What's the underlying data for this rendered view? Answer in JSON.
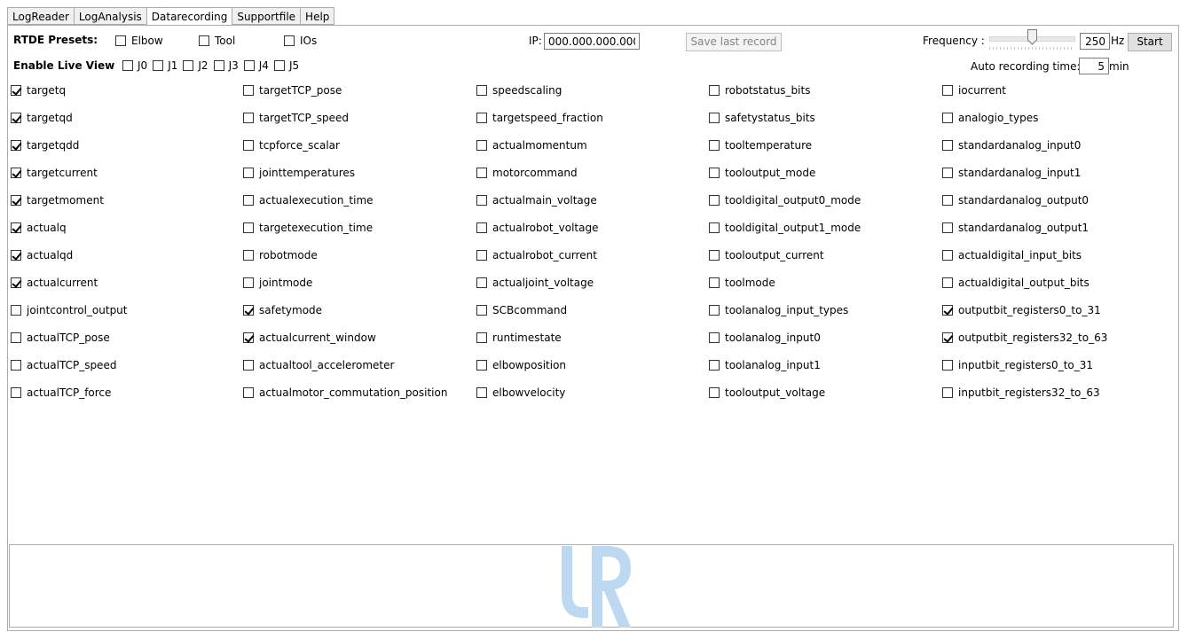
{
  "tabs": [
    "LogReader",
    "LogAnalysis",
    "Datarecording",
    "Supportfile",
    "Help"
  ],
  "active_tab": "Datarecording",
  "presets": {
    "label": "RTDE Presets:",
    "items": [
      {
        "label": "Elbow",
        "checked": false
      },
      {
        "label": "Tool",
        "checked": false
      },
      {
        "label": "IOs",
        "checked": false
      }
    ]
  },
  "ip": {
    "label": "IP:",
    "value": "000.000.000.000"
  },
  "save_button": "Save last record",
  "frequency": {
    "label": "Frequency :",
    "value": "250",
    "unit": "Hz",
    "slider_fraction": 0.5
  },
  "start_button": "Start",
  "live_view": {
    "label": "Enable Live View",
    "joints": [
      {
        "label": "J0",
        "checked": false
      },
      {
        "label": "J1",
        "checked": false
      },
      {
        "label": "J2",
        "checked": false
      },
      {
        "label": "J3",
        "checked": false
      },
      {
        "label": "J4",
        "checked": false
      },
      {
        "label": "J5",
        "checked": false
      }
    ]
  },
  "auto_recording": {
    "label": "Auto recording time:",
    "value": "5",
    "unit": "min"
  },
  "columns": [
    [
      {
        "label": "targetq",
        "checked": true
      },
      {
        "label": "targetqd",
        "checked": true
      },
      {
        "label": "targetqdd",
        "checked": true
      },
      {
        "label": "targetcurrent",
        "checked": true
      },
      {
        "label": "targetmoment",
        "checked": true
      },
      {
        "label": "actualq",
        "checked": true
      },
      {
        "label": "actualqd",
        "checked": true
      },
      {
        "label": "actualcurrent",
        "checked": true
      },
      {
        "label": "jointcontrol_output",
        "checked": false
      },
      {
        "label": "actualTCP_pose",
        "checked": false
      },
      {
        "label": "actualTCP_speed",
        "checked": false
      },
      {
        "label": "actualTCP_force",
        "checked": false
      }
    ],
    [
      {
        "label": "targetTCP_pose",
        "checked": false
      },
      {
        "label": "targetTCP_speed",
        "checked": false
      },
      {
        "label": "tcpforce_scalar",
        "checked": false
      },
      {
        "label": "jointtemperatures",
        "checked": false
      },
      {
        "label": "actualexecution_time",
        "checked": false
      },
      {
        "label": "targetexecution_time",
        "checked": false
      },
      {
        "label": "robotmode",
        "checked": false
      },
      {
        "label": "jointmode",
        "checked": false
      },
      {
        "label": "safetymode",
        "checked": true
      },
      {
        "label": "actualcurrent_window",
        "checked": true
      },
      {
        "label": "actualtool_accelerometer",
        "checked": false
      },
      {
        "label": "actualmotor_commutation_position",
        "checked": false
      }
    ],
    [
      {
        "label": "speedscaling",
        "checked": false
      },
      {
        "label": "targetspeed_fraction",
        "checked": false
      },
      {
        "label": "actualmomentum",
        "checked": false
      },
      {
        "label": "motorcommand",
        "checked": false
      },
      {
        "label": "actualmain_voltage",
        "checked": false
      },
      {
        "label": "actualrobot_voltage",
        "checked": false
      },
      {
        "label": "actualrobot_current",
        "checked": false
      },
      {
        "label": "actualjoint_voltage",
        "checked": false
      },
      {
        "label": "SCBcommand",
        "checked": false
      },
      {
        "label": "runtimestate",
        "checked": false
      },
      {
        "label": "elbowposition",
        "checked": false
      },
      {
        "label": "elbowvelocity",
        "checked": false
      }
    ],
    [
      {
        "label": "robotstatus_bits",
        "checked": false
      },
      {
        "label": "safetystatus_bits",
        "checked": false
      },
      {
        "label": "tooltemperature",
        "checked": false
      },
      {
        "label": "tooloutput_mode",
        "checked": false
      },
      {
        "label": "tooldigital_output0_mode",
        "checked": false
      },
      {
        "label": "tooldigital_output1_mode",
        "checked": false
      },
      {
        "label": "tooloutput_current",
        "checked": false
      },
      {
        "label": "toolmode",
        "checked": false
      },
      {
        "label": "toolanalog_input_types",
        "checked": false
      },
      {
        "label": "toolanalog_input0",
        "checked": false
      },
      {
        "label": "toolanalog_input1",
        "checked": false
      },
      {
        "label": "tooloutput_voltage",
        "checked": false
      }
    ],
    [
      {
        "label": "iocurrent",
        "checked": false
      },
      {
        "label": "analogio_types",
        "checked": false
      },
      {
        "label": "standardanalog_input0",
        "checked": false
      },
      {
        "label": "standardanalog_input1",
        "checked": false
      },
      {
        "label": "standardanalog_output0",
        "checked": false
      },
      {
        "label": "standardanalog_output1",
        "checked": false
      },
      {
        "label": "actualdigital_input_bits",
        "checked": false
      },
      {
        "label": "actualdigital_output_bits",
        "checked": false
      },
      {
        "label": "outputbit_registers0_to_31",
        "checked": true
      },
      {
        "label": "outputbit_registers32_to_63",
        "checked": true
      },
      {
        "label": "inputbit_registers0_to_31",
        "checked": false
      },
      {
        "label": "inputbit_registers32_to_63",
        "checked": false
      }
    ]
  ],
  "colors": {
    "logo": "#bcd9f1",
    "border": "#acacac"
  },
  "logo_icon": "ur-logo-icon"
}
